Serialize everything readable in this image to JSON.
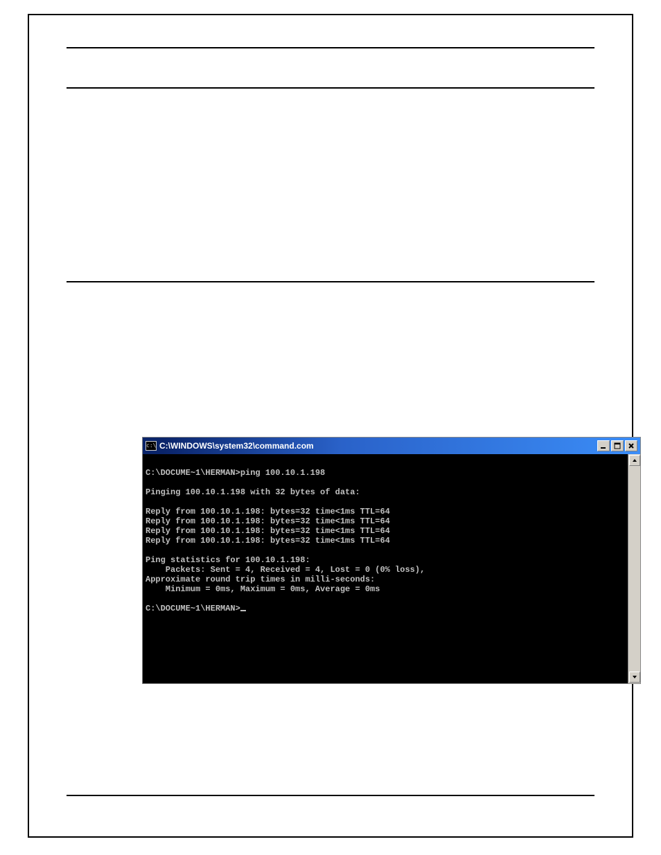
{
  "cmd": {
    "title": "C:\\WINDOWS\\system32\\command.com",
    "lines": [
      "",
      "C:\\DOCUME~1\\HERMAN>ping 100.10.1.198",
      "",
      "Pinging 100.10.1.198 with 32 bytes of data:",
      "",
      "Reply from 100.10.1.198: bytes=32 time<1ms TTL=64",
      "Reply from 100.10.1.198: bytes=32 time<1ms TTL=64",
      "Reply from 100.10.1.198: bytes=32 time<1ms TTL=64",
      "Reply from 100.10.1.198: bytes=32 time<1ms TTL=64",
      "",
      "Ping statistics for 100.10.1.198:",
      "    Packets: Sent = 4, Received = 4, Lost = 0 (0% loss),",
      "Approximate round trip times in milli-seconds:",
      "    Minimum = 0ms, Maximum = 0ms, Average = 0ms",
      "",
      "C:\\DOCUME~1\\HERMAN>"
    ],
    "buttons": {
      "minimize": "minimize",
      "maximize": "maximize",
      "close": "close"
    }
  }
}
